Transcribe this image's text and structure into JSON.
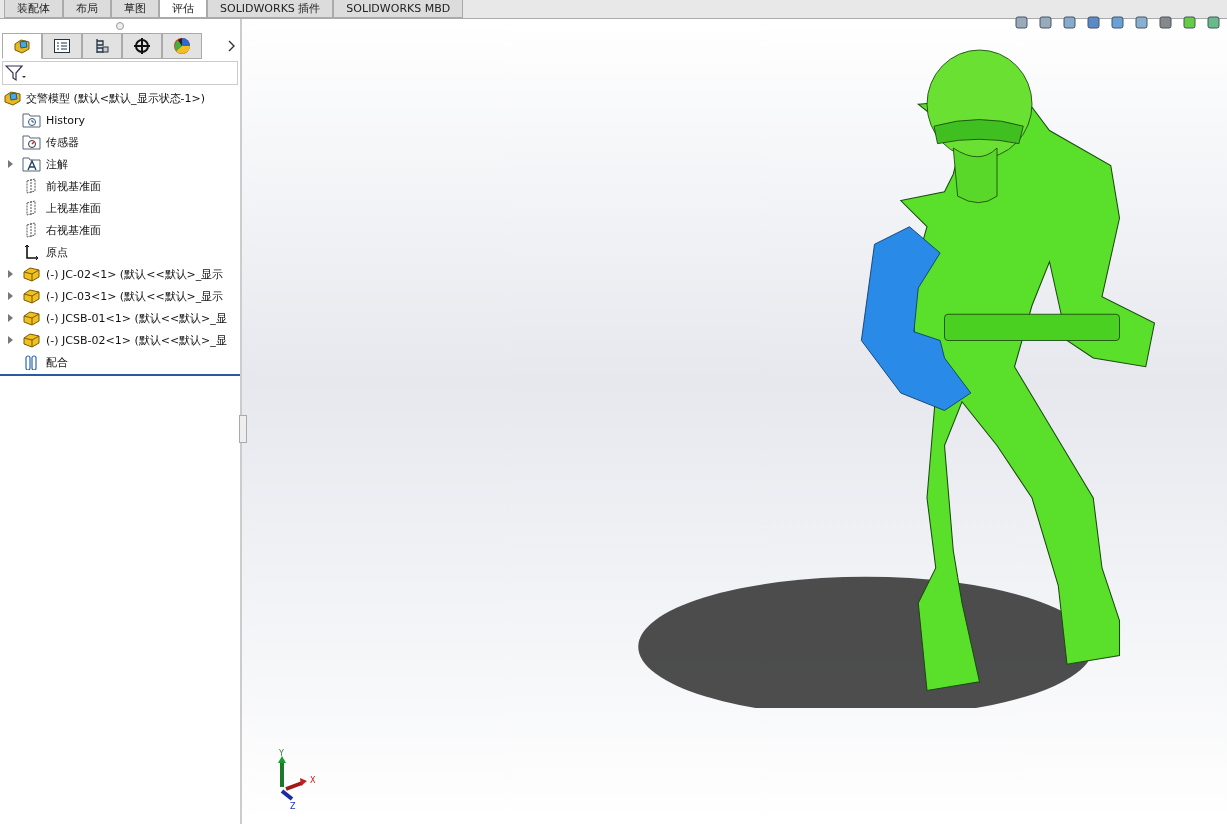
{
  "command_tabs": [
    {
      "label": "装配体",
      "selected": false
    },
    {
      "label": "布局",
      "selected": false
    },
    {
      "label": "草图",
      "selected": false
    },
    {
      "label": "评估",
      "selected": true
    },
    {
      "label": "SOLIDWORKS 插件",
      "selected": false
    },
    {
      "label": "SOLIDWORKS MBD",
      "selected": false
    }
  ],
  "panel_tabs": [
    {
      "kind": "feature-tree",
      "selected": true
    },
    {
      "kind": "property",
      "selected": false
    },
    {
      "kind": "configuration",
      "selected": false
    },
    {
      "kind": "dimxpert",
      "selected": false
    },
    {
      "kind": "display",
      "selected": false
    }
  ],
  "tree": {
    "root": {
      "label": "交警模型  (默认<默认_显示状态-1>)"
    },
    "items": [
      {
        "kind": "history",
        "label": "History",
        "expander": false
      },
      {
        "kind": "sensor",
        "label": "传感器",
        "expander": false
      },
      {
        "kind": "annotation",
        "label": "注解",
        "expander": true
      },
      {
        "kind": "plane",
        "label": "前视基准面",
        "expander": false
      },
      {
        "kind": "plane",
        "label": "上视基准面",
        "expander": false
      },
      {
        "kind": "plane",
        "label": "右视基准面",
        "expander": false
      },
      {
        "kind": "origin",
        "label": "原点",
        "expander": false
      },
      {
        "kind": "part",
        "label": "(-) JC-02<1> (默认<<默认>_显示",
        "expander": true
      },
      {
        "kind": "part",
        "label": "(-) JC-03<1> (默认<<默认>_显示",
        "expander": true
      },
      {
        "kind": "part",
        "label": "(-) JCSB-01<1> (默认<<默认>_显",
        "expander": true
      },
      {
        "kind": "part",
        "label": "(-) JCSB-02<1> (默认<<默认>_显",
        "expander": true
      },
      {
        "kind": "mate",
        "label": "配合",
        "expander": false
      }
    ]
  },
  "triad": {
    "x": "X",
    "y": "Y",
    "z": "Z"
  }
}
